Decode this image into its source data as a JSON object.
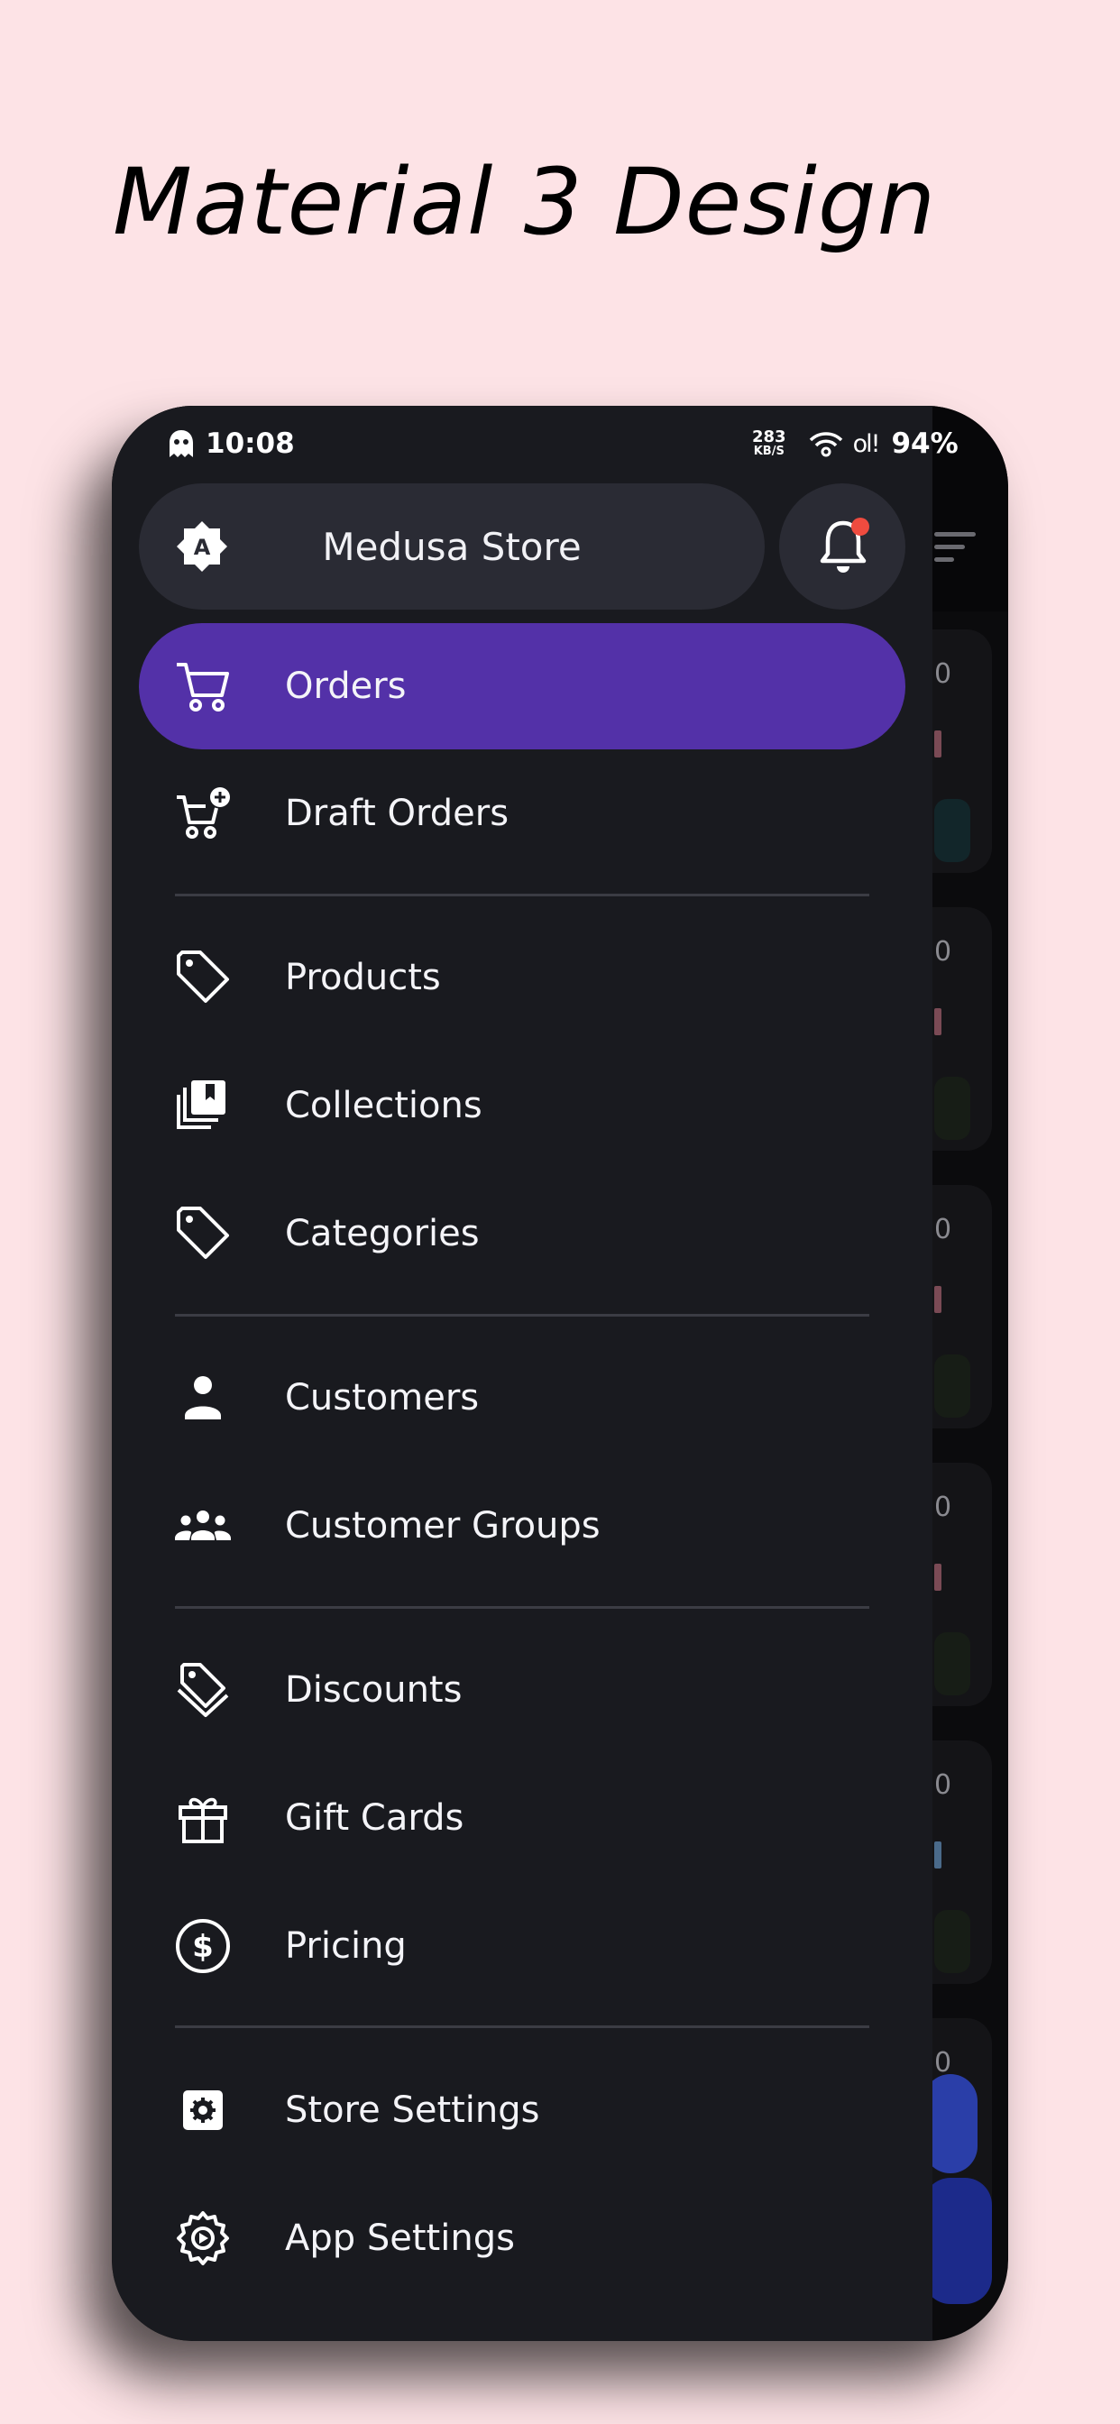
{
  "headline": "Material 3 Design",
  "status_bar": {
    "time": "10:08",
    "net_speed": "283",
    "net_unit": "KB/S",
    "signal": "ol!",
    "battery": "94%"
  },
  "drawer": {
    "store_name": "Medusa Store",
    "theme_icon": "brightness-auto-icon",
    "notification_icon": "bell-icon",
    "has_notification": true,
    "accent_color": "#5331a8",
    "items": [
      {
        "label": "Orders",
        "icon": "cart-icon",
        "active": true
      },
      {
        "label": "Draft Orders",
        "icon": "cart-plus-icon",
        "active": false
      },
      {
        "label": "Products",
        "icon": "tag-icon",
        "active": false
      },
      {
        "label": "Collections",
        "icon": "collections-icon",
        "active": false
      },
      {
        "label": "Categories",
        "icon": "tag-icon",
        "active": false
      },
      {
        "label": "Customers",
        "icon": "person-icon",
        "active": false
      },
      {
        "label": "Customer Groups",
        "icon": "groups-icon",
        "active": false
      },
      {
        "label": "Discounts",
        "icon": "discount-icon",
        "active": false
      },
      {
        "label": "Gift Cards",
        "icon": "gift-icon",
        "active": false
      },
      {
        "label": "Pricing",
        "icon": "dollar-icon",
        "active": false
      },
      {
        "label": "Store Settings",
        "icon": "store-settings-icon",
        "active": false
      },
      {
        "label": "App Settings",
        "icon": "app-settings-icon",
        "active": false
      }
    ]
  },
  "background": {
    "card_digits": [
      "0",
      "0",
      "0",
      "0",
      "0",
      "0"
    ]
  }
}
